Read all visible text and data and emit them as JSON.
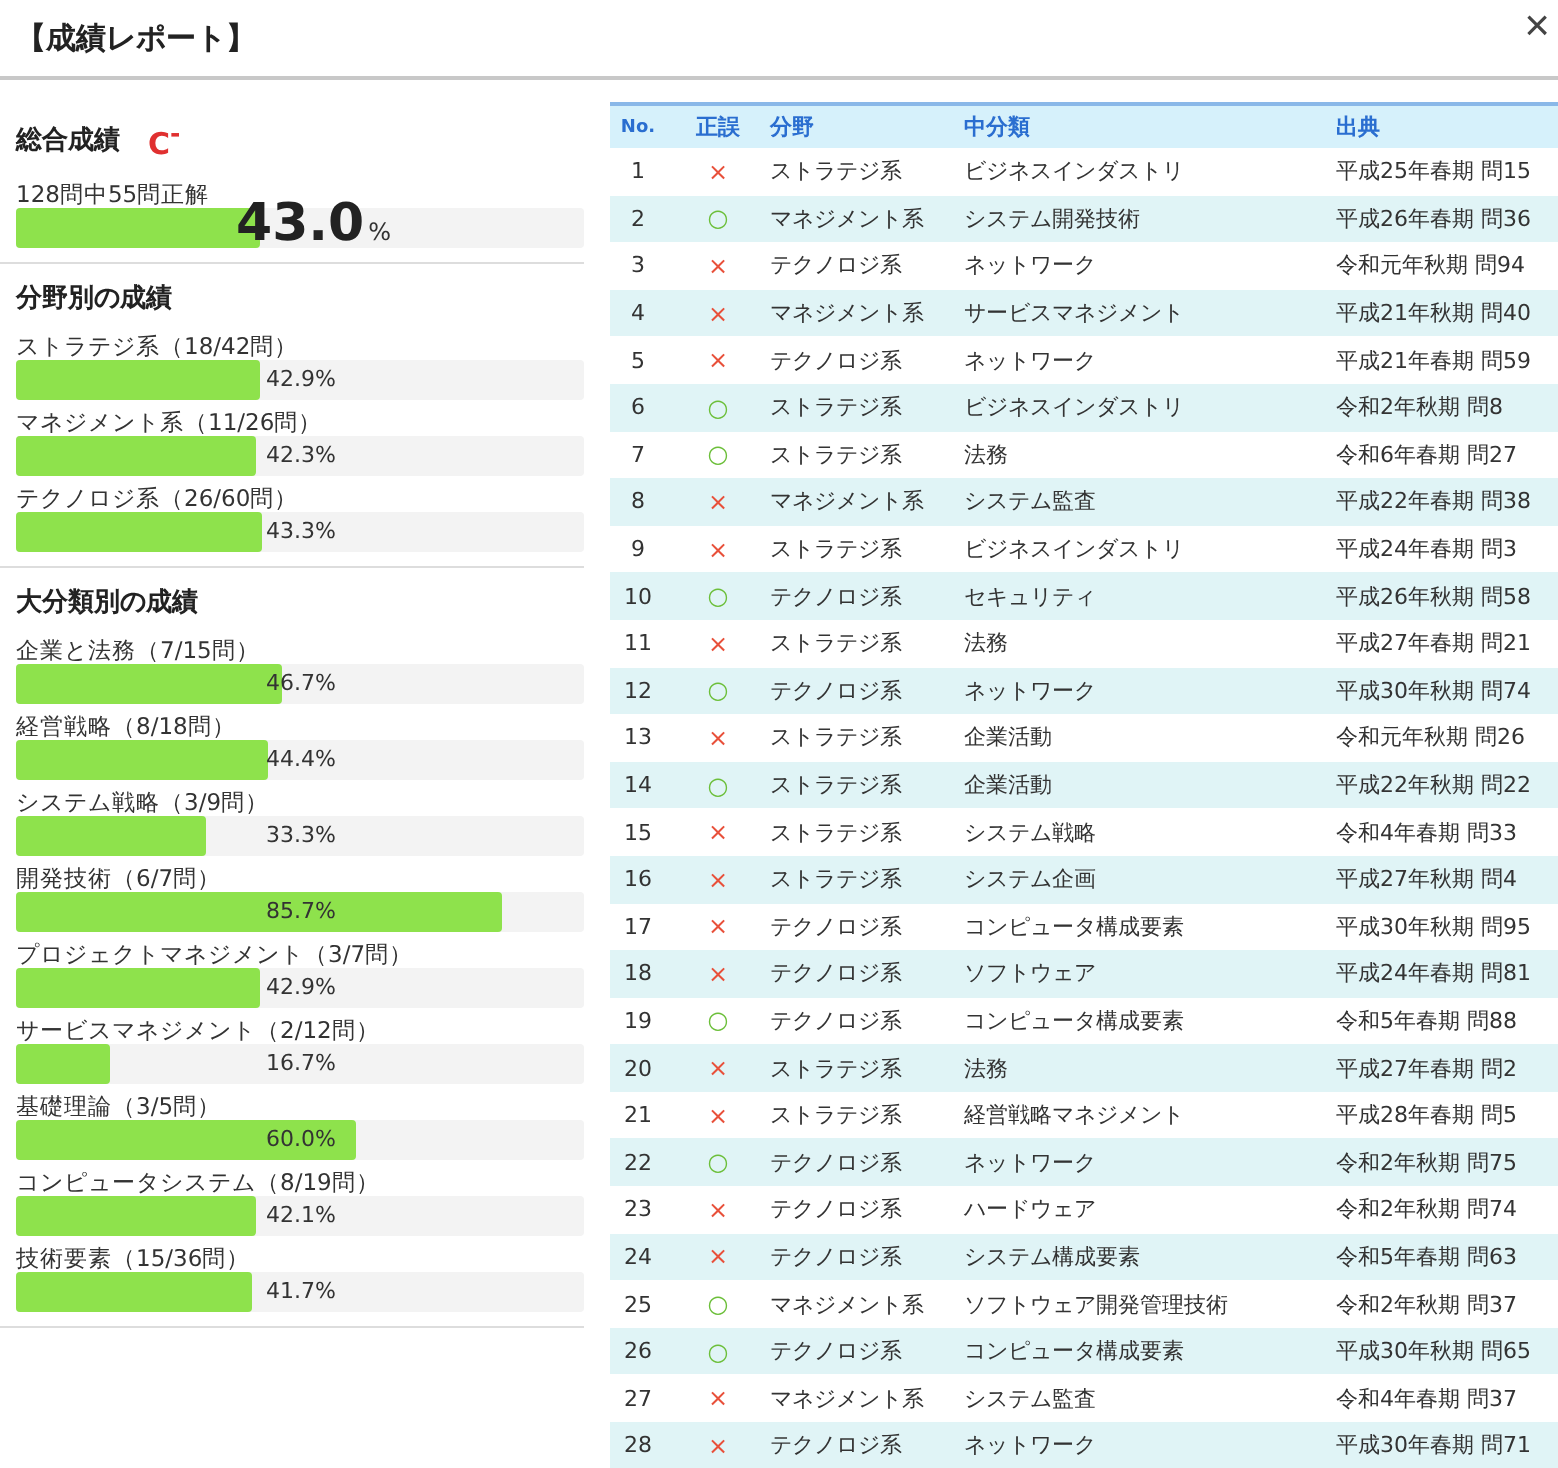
{
  "window": {
    "title": "【成績レポート】",
    "close": "×"
  },
  "overall": {
    "heading": "総合成績",
    "grade": "C$^{-}$",
    "summary": "128問中55問正解",
    "level": 0.43,
    "score": "43.0",
    "unit": "%"
  },
  "by_field": {
    "heading": "分野別の成績",
    "items": [
      {
        "label": "ストラテジ系（18/42問）",
        "level": 0.429,
        "reading": "42.9%"
      },
      {
        "label": "マネジメント系（11/26問）",
        "level": 0.423,
        "reading": "42.3%"
      },
      {
        "label": "テクノロジ系（26/60問）",
        "level": 0.433,
        "reading": "43.3%"
      }
    ]
  },
  "by_category": {
    "heading": "大分類別の成績",
    "items": [
      {
        "label": "企業と法務（7/15問）",
        "level": 0.467,
        "reading": "46.7%"
      },
      {
        "label": "経営戦略（8/18問）",
        "level": 0.444,
        "reading": "44.4%"
      },
      {
        "label": "システム戦略（3/9問）",
        "level": 0.333,
        "reading": "33.3%"
      },
      {
        "label": "開発技術（6/7問）",
        "level": 0.857,
        "reading": "85.7%"
      },
      {
        "label": "プロジェクトマネジメント（3/7問）",
        "level": 0.429,
        "reading": "42.9%"
      },
      {
        "label": "サービスマネジメント（2/12問）",
        "level": 0.167,
        "reading": "16.7%"
      },
      {
        "label": "基礎理論（3/5問）",
        "level": 0.6,
        "reading": "60.0%"
      },
      {
        "label": "コンピュータシステム（8/19問）",
        "level": 0.421,
        "reading": "42.1%"
      },
      {
        "label": "技術要素（15/36問）",
        "level": 0.417,
        "reading": "41.7%"
      }
    ]
  },
  "table": {
    "columns": [
      "No.",
      "正誤",
      "分野",
      "中分類",
      "出典"
    ],
    "rows": [
      {
        "no": "1",
        "mark": "×",
        "correct": false,
        "field": "ストラテジ系",
        "category": "ビジネスインダストリ",
        "source": "平成25年春期 問15"
      },
      {
        "no": "2",
        "mark": "○",
        "correct": true,
        "field": "マネジメント系",
        "category": "システム開発技術",
        "source": "平成26年春期 問36"
      },
      {
        "no": "3",
        "mark": "×",
        "correct": false,
        "field": "テクノロジ系",
        "category": "ネットワーク",
        "source": "令和元年秋期 問94"
      },
      {
        "no": "4",
        "mark": "×",
        "correct": false,
        "field": "マネジメント系",
        "category": "サービスマネジメント",
        "source": "平成21年秋期 問40"
      },
      {
        "no": "5",
        "mark": "×",
        "correct": false,
        "field": "テクノロジ系",
        "category": "ネットワーク",
        "source": "平成21年春期 問59"
      },
      {
        "no": "6",
        "mark": "○",
        "correct": true,
        "field": "ストラテジ系",
        "category": "ビジネスインダストリ",
        "source": "令和2年秋期 問8"
      },
      {
        "no": "7",
        "mark": "○",
        "correct": true,
        "field": "ストラテジ系",
        "category": "法務",
        "source": "令和6年春期 問27"
      },
      {
        "no": "8",
        "mark": "×",
        "correct": false,
        "field": "マネジメント系",
        "category": "システム監査",
        "source": "平成22年春期 問38"
      },
      {
        "no": "9",
        "mark": "×",
        "correct": false,
        "field": "ストラテジ系",
        "category": "ビジネスインダストリ",
        "source": "平成24年春期 問3"
      },
      {
        "no": "10",
        "mark": "○",
        "correct": true,
        "field": "テクノロジ系",
        "category": "セキュリティ",
        "source": "平成26年秋期 問58"
      },
      {
        "no": "11",
        "mark": "×",
        "correct": false,
        "field": "ストラテジ系",
        "category": "法務",
        "source": "平成27年春期 問21"
      },
      {
        "no": "12",
        "mark": "○",
        "correct": true,
        "field": "テクノロジ系",
        "category": "ネットワーク",
        "source": "平成30年秋期 問74"
      },
      {
        "no": "13",
        "mark": "×",
        "correct": false,
        "field": "ストラテジ系",
        "category": "企業活動",
        "source": "令和元年秋期 問26"
      },
      {
        "no": "14",
        "mark": "○",
        "correct": true,
        "field": "ストラテジ系",
        "category": "企業活動",
        "source": "平成22年秋期 問22"
      },
      {
        "no": "15",
        "mark": "×",
        "correct": false,
        "field": "ストラテジ系",
        "category": "システム戦略",
        "source": "令和4年春期 問33"
      },
      {
        "no": "16",
        "mark": "×",
        "correct": false,
        "field": "ストラテジ系",
        "category": "システム企画",
        "source": "平成27年秋期 問4"
      },
      {
        "no": "17",
        "mark": "×",
        "correct": false,
        "field": "テクノロジ系",
        "category": "コンピュータ構成要素",
        "source": "平成30年秋期 問95"
      },
      {
        "no": "18",
        "mark": "×",
        "correct": false,
        "field": "テクノロジ系",
        "category": "ソフトウェア",
        "source": "平成24年春期 問81"
      },
      {
        "no": "19",
        "mark": "○",
        "correct": true,
        "field": "テクノロジ系",
        "category": "コンピュータ構成要素",
        "source": "令和5年春期 問88"
      },
      {
        "no": "20",
        "mark": "×",
        "correct": false,
        "field": "ストラテジ系",
        "category": "法務",
        "source": "平成27年春期 問2"
      },
      {
        "no": "21",
        "mark": "×",
        "correct": false,
        "field": "ストラテジ系",
        "category": "経営戦略マネジメント",
        "source": "平成28年春期 問5"
      },
      {
        "no": "22",
        "mark": "○",
        "correct": true,
        "field": "テクノロジ系",
        "category": "ネットワーク",
        "source": "令和2年秋期 問75"
      },
      {
        "no": "23",
        "mark": "×",
        "correct": false,
        "field": "テクノロジ系",
        "category": "ハードウェア",
        "source": "令和2年秋期 問74"
      },
      {
        "no": "24",
        "mark": "×",
        "correct": false,
        "field": "テクノロジ系",
        "category": "システム構成要素",
        "source": "令和5年春期 問63"
      },
      {
        "no": "25",
        "mark": "○",
        "correct": true,
        "field": "マネジメント系",
        "category": "ソフトウェア開発管理技術",
        "source": "令和2年秋期 問37"
      },
      {
        "no": "26",
        "mark": "○",
        "correct": true,
        "field": "テクノロジ系",
        "category": "コンピュータ構成要素",
        "source": "平成30年秋期 問65"
      },
      {
        "no": "27",
        "mark": "×",
        "correct": false,
        "field": "マネジメント系",
        "category": "システム監査",
        "source": "令和4年春期 問37"
      },
      {
        "no": "28",
        "mark": "×",
        "correct": false,
        "field": "テクノロジ系",
        "category": "ネットワーク",
        "source": "平成30年春期 問71"
      }
    ]
  }
}
